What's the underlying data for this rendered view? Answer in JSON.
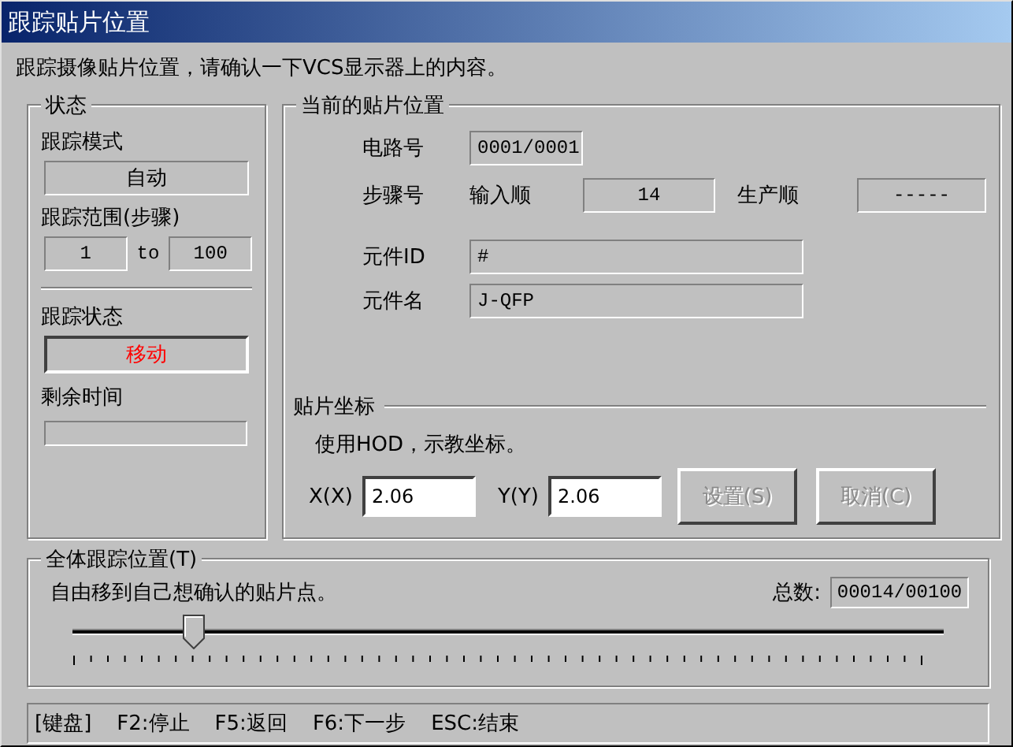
{
  "window": {
    "title": "跟踪贴片位置"
  },
  "instruction": "跟踪摄像贴片位置，请确认一下VCS显示器上的内容。",
  "status_group": {
    "title": "状态",
    "mode_label": "跟踪模式",
    "mode_value": "自动",
    "range_label": "跟踪范围(步骤)",
    "range_from": "1",
    "range_to_label": "to",
    "range_to": "100",
    "state_label": "跟踪状态",
    "state_value": "移动",
    "remaining": {
      "label": "剩余时间",
      "level": 0
    }
  },
  "position_group": {
    "title": "当前的贴片位置",
    "circuit_label": "电路号",
    "circuit_value": "0001/0001",
    "step_label": "步骤号",
    "input_order_label": "输入顺",
    "input_order_value": "14",
    "production_order_label": "生产顺",
    "production_order_value": "-----",
    "part_id_label": "元件ID",
    "part_id_value": "#",
    "part_name_label": "元件名",
    "part_name_value": "J-QFP",
    "coords": {
      "title": "贴片坐标",
      "hint": "使用HOD，示教坐标。",
      "x_label": "X(X)",
      "x_value": "2.06",
      "y_label": "Y(Y)",
      "y_value": "2.06",
      "buttons": [
        {
          "label": "设置(S)",
          "disabled": true
        },
        {
          "label": "取消(C)",
          "disabled": true
        }
      ]
    }
  },
  "overall": {
    "title": "全体跟踪位置(T)",
    "hint": "自由移到自己想确认的贴片点。",
    "total_label": "总数:",
    "total_value": "00014/00100",
    "slider": {
      "level": 0.14
    }
  },
  "keys": [
    "[键盘]",
    "F2:停止",
    "F5:返回",
    "F6:下一步",
    "ESC:结束"
  ]
}
